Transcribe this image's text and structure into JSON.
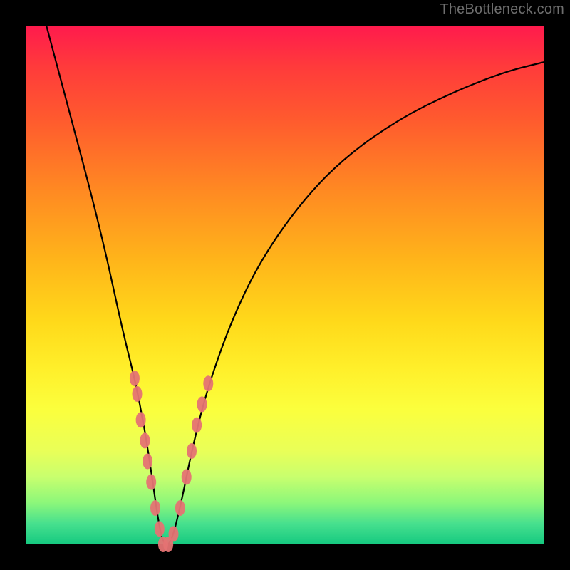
{
  "watermark": "TheBottleneck.com",
  "colors": {
    "frame": "#000000",
    "curve": "#000000",
    "marker_fill": "#e57373",
    "marker_stroke": "#d46060"
  },
  "chart_data": {
    "type": "line",
    "title": "",
    "xlabel": "",
    "ylabel": "",
    "xlim": [
      0,
      100
    ],
    "ylim": [
      0,
      100
    ],
    "series": [
      {
        "name": "bottleneck-curve",
        "x": [
          4,
          8,
          12,
          15,
          17,
          19,
          21,
          23,
          24.5,
          25.5,
          26.5,
          28,
          30,
          32,
          35,
          40,
          46,
          54,
          62,
          72,
          82,
          92,
          100
        ],
        "y": [
          100,
          85,
          70,
          58,
          49,
          40,
          32,
          22,
          12,
          5,
          0,
          0,
          8,
          18,
          30,
          44,
          56,
          67,
          75,
          82,
          87,
          91,
          93
        ]
      }
    ],
    "markers": [
      {
        "x": 21.0,
        "y": 32
      },
      {
        "x": 21.5,
        "y": 29
      },
      {
        "x": 22.2,
        "y": 24
      },
      {
        "x": 23.0,
        "y": 20
      },
      {
        "x": 23.5,
        "y": 16
      },
      {
        "x": 24.2,
        "y": 12
      },
      {
        "x": 25.0,
        "y": 7
      },
      {
        "x": 25.8,
        "y": 3
      },
      {
        "x": 26.5,
        "y": 0
      },
      {
        "x": 27.5,
        "y": 0
      },
      {
        "x": 28.5,
        "y": 2
      },
      {
        "x": 29.8,
        "y": 7
      },
      {
        "x": 31.0,
        "y": 13
      },
      {
        "x": 32.0,
        "y": 18
      },
      {
        "x": 33.0,
        "y": 23
      },
      {
        "x": 34.0,
        "y": 27
      },
      {
        "x": 35.2,
        "y": 31
      }
    ]
  }
}
